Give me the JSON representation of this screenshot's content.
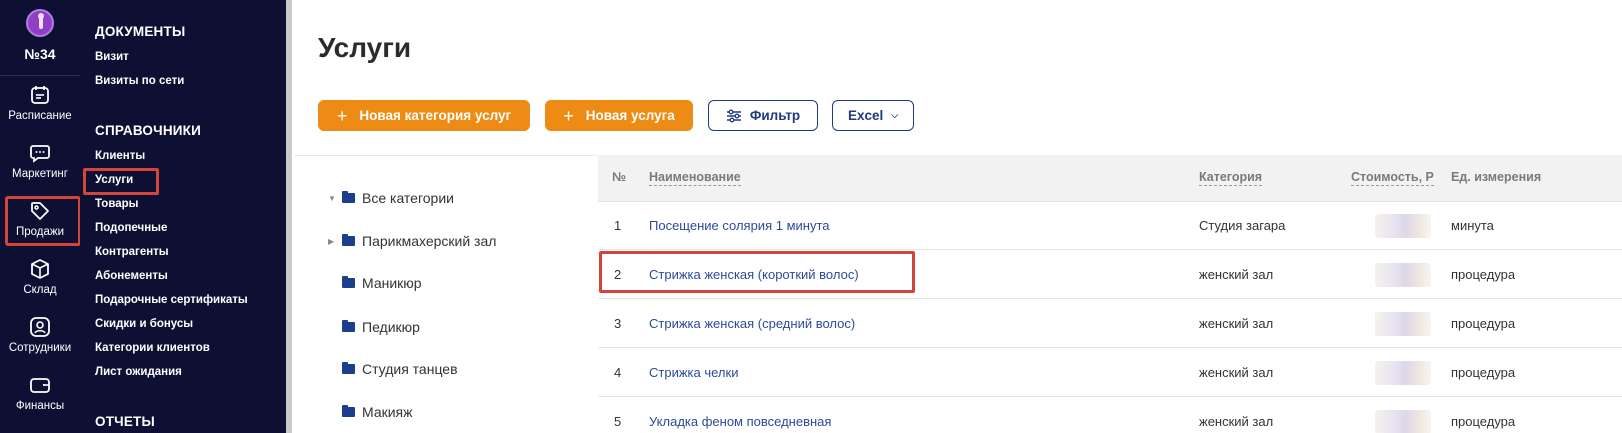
{
  "rail": {
    "org_number": "№34",
    "items": [
      {
        "label": "Расписание",
        "icon": "calendar-icon"
      },
      {
        "label": "Маркетинг",
        "icon": "chat-icon"
      },
      {
        "label": "Продажи",
        "icon": "tag-icon"
      },
      {
        "label": "Склад",
        "icon": "box-icon"
      },
      {
        "label": "Сотрудники",
        "icon": "user-icon"
      },
      {
        "label": "Финансы",
        "icon": "wallet-icon"
      }
    ]
  },
  "submenu": {
    "section_documents": "ДОКУМЕНТЫ",
    "documents": [
      "Визит",
      "Визиты по сети"
    ],
    "section_references": "СПРАВОЧНИКИ",
    "references": [
      "Клиенты",
      "Услуги",
      "Товары",
      "Подопечные",
      "Контрагенты",
      "Абонементы",
      "Подарочные сертификаты",
      "Скидки и бонусы",
      "Категории клиентов",
      "Лист ожидания"
    ],
    "section_reports": "ОТЧЕТЫ"
  },
  "page": {
    "title": "Услуги",
    "new_category_button": "Новая категория услуг",
    "new_service_button": "Новая услуга",
    "filter_button": "Фильтр",
    "excel_button": "Excel"
  },
  "tree": [
    {
      "label": "Все категории",
      "caret": "down"
    },
    {
      "label": "Парикмахерский зал",
      "caret": "right"
    },
    {
      "label": "Маникюр",
      "caret": ""
    },
    {
      "label": "Педикюр",
      "caret": ""
    },
    {
      "label": "Студия танцев",
      "caret": ""
    },
    {
      "label": "Макияж",
      "caret": ""
    }
  ],
  "table": {
    "headers": {
      "num": "№",
      "name": "Наименование",
      "category": "Категория",
      "price": "Стоимость, Р",
      "unit": "Ед. измерения"
    },
    "rows": [
      {
        "num": "1",
        "name": "Посещение солярия 1 минута",
        "category": "Студия загара",
        "unit": "минута"
      },
      {
        "num": "2",
        "name": "Стрижка женская (короткий волос)",
        "category": "женский зал",
        "unit": "процедура"
      },
      {
        "num": "3",
        "name": "Стрижка женская (средний волос)",
        "category": "женский зал",
        "unit": "процедура"
      },
      {
        "num": "4",
        "name": "Стрижка челки",
        "category": "женский зал",
        "unit": "процедура"
      },
      {
        "num": "5",
        "name": "Укладка феном повседневная",
        "category": "женский зал",
        "unit": "процедура"
      }
    ]
  },
  "colors": {
    "sidebar": "#0d1033",
    "accent": "#ee8b14",
    "link": "#2c4a9c",
    "highlight": "#d2453a"
  }
}
